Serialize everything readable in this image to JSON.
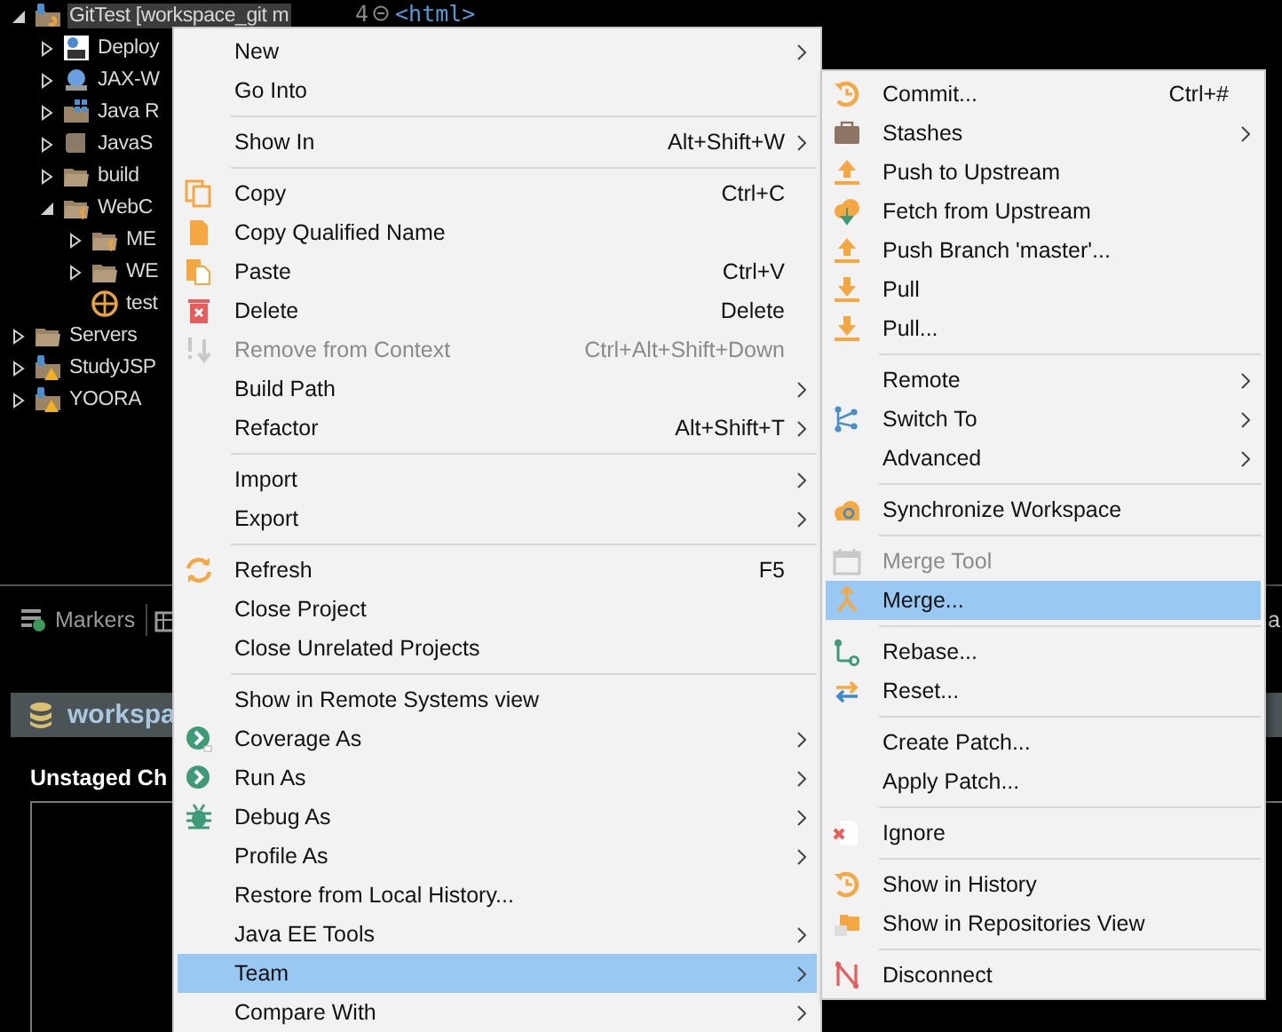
{
  "project_explorer": {
    "items": [
      {
        "label": "GitTest [workspace_git m",
        "expanded": true,
        "selected": true,
        "children": [
          {
            "label": "Deploy",
            "expanded": false,
            "selected": false
          },
          {
            "label": "JAX-W",
            "expanded": false,
            "selected": false
          },
          {
            "label": "Java R",
            "expanded": false,
            "selected": false
          },
          {
            "label": "JavaS",
            "expanded": false,
            "selected": false
          },
          {
            "label": "build",
            "expanded": false,
            "selected": false
          },
          {
            "label": "WebC",
            "expanded": true,
            "selected": false,
            "children": [
              {
                "label": "ME",
                "expanded": false,
                "selected": false
              },
              {
                "label": "WE",
                "expanded": false,
                "selected": false
              },
              {
                "label": "test",
                "selected": false
              }
            ]
          }
        ]
      },
      {
        "label": "Servers",
        "expanded": false,
        "selected": false
      },
      {
        "label": "StudyJSP",
        "expanded": false,
        "selected": false
      },
      {
        "label": "YOORA",
        "expanded": false,
        "selected": false
      }
    ]
  },
  "editor": {
    "line_number": "4",
    "code": "<html>"
  },
  "bottom_panel": {
    "tabs": [
      {
        "label": "Markers"
      }
    ],
    "edge_text": "a"
  },
  "staging_view": {
    "title": "workspa",
    "section": "Unstaged Ch"
  },
  "context_menu": {
    "groups": [
      [
        {
          "label": "New",
          "submenu": true,
          "disabled": false,
          "selected": false
        },
        {
          "label": "Go Into",
          "submenu": false,
          "disabled": false,
          "selected": false
        }
      ],
      [
        {
          "label": "Show In",
          "shortcut": "Alt+Shift+W",
          "submenu": true,
          "disabled": false,
          "selected": false
        }
      ],
      [
        {
          "label": "Copy",
          "shortcut": "Ctrl+C",
          "submenu": false,
          "disabled": false,
          "selected": false
        },
        {
          "label": "Copy Qualified Name",
          "submenu": false,
          "disabled": false,
          "selected": false
        },
        {
          "label": "Paste",
          "shortcut": "Ctrl+V",
          "submenu": false,
          "disabled": false,
          "selected": false
        },
        {
          "label": "Delete",
          "shortcut": "Delete",
          "submenu": false,
          "disabled": false,
          "selected": false
        },
        {
          "label": "Remove from Context",
          "shortcut": "Ctrl+Alt+Shift+Down",
          "submenu": false,
          "disabled": true,
          "selected": false
        },
        {
          "label": "Build Path",
          "submenu": true,
          "disabled": false,
          "selected": false
        },
        {
          "label": "Refactor",
          "shortcut": "Alt+Shift+T",
          "submenu": true,
          "disabled": false,
          "selected": false
        }
      ],
      [
        {
          "label": "Import",
          "submenu": true,
          "disabled": false,
          "selected": false
        },
        {
          "label": "Export",
          "submenu": true,
          "disabled": false,
          "selected": false
        }
      ],
      [
        {
          "label": "Refresh",
          "shortcut": "F5",
          "submenu": false,
          "disabled": false,
          "selected": false
        },
        {
          "label": "Close Project",
          "submenu": false,
          "disabled": false,
          "selected": false
        },
        {
          "label": "Close Unrelated Projects",
          "submenu": false,
          "disabled": false,
          "selected": false
        }
      ],
      [
        {
          "label": "Show in Remote Systems view",
          "submenu": false,
          "disabled": false,
          "selected": false
        },
        {
          "label": "Coverage As",
          "submenu": true,
          "disabled": false,
          "selected": false
        },
        {
          "label": "Run As",
          "submenu": true,
          "disabled": false,
          "selected": false
        },
        {
          "label": "Debug As",
          "submenu": true,
          "disabled": false,
          "selected": false
        },
        {
          "label": "Profile As",
          "submenu": true,
          "disabled": false,
          "selected": false
        },
        {
          "label": "Restore from Local History...",
          "submenu": false,
          "disabled": false,
          "selected": false
        },
        {
          "label": "Java EE Tools",
          "submenu": true,
          "disabled": false,
          "selected": false
        },
        {
          "label": "Team",
          "submenu": true,
          "disabled": false,
          "selected": true
        },
        {
          "label": "Compare With",
          "submenu": true,
          "disabled": false,
          "selected": false
        }
      ]
    ]
  },
  "team_submenu": {
    "groups": [
      [
        {
          "label": "Commit...",
          "shortcut": "Ctrl+#",
          "submenu": false,
          "disabled": false,
          "selected": false
        },
        {
          "label": "Stashes",
          "submenu": true,
          "disabled": false,
          "selected": false
        },
        {
          "label": "Push to Upstream",
          "submenu": false,
          "disabled": false,
          "selected": false
        },
        {
          "label": "Fetch from Upstream",
          "submenu": false,
          "disabled": false,
          "selected": false
        },
        {
          "label": "Push Branch 'master'...",
          "submenu": false,
          "disabled": false,
          "selected": false
        },
        {
          "label": "Pull",
          "submenu": false,
          "disabled": false,
          "selected": false
        },
        {
          "label": "Pull...",
          "submenu": false,
          "disabled": false,
          "selected": false
        }
      ],
      [
        {
          "label": "Remote",
          "submenu": true,
          "disabled": false,
          "selected": false
        },
        {
          "label": "Switch To",
          "submenu": true,
          "disabled": false,
          "selected": false
        },
        {
          "label": "Advanced",
          "submenu": true,
          "disabled": false,
          "selected": false
        }
      ],
      [
        {
          "label": "Synchronize Workspace",
          "submenu": false,
          "disabled": false,
          "selected": false
        }
      ],
      [
        {
          "label": "Merge Tool",
          "submenu": false,
          "disabled": true,
          "selected": false
        },
        {
          "label": "Merge...",
          "submenu": false,
          "disabled": false,
          "selected": true
        }
      ],
      [
        {
          "label": "Rebase...",
          "submenu": false,
          "disabled": false,
          "selected": false
        },
        {
          "label": "Reset...",
          "submenu": false,
          "disabled": false,
          "selected": false
        }
      ],
      [
        {
          "label": "Create Patch...",
          "submenu": false,
          "disabled": false,
          "selected": false
        },
        {
          "label": "Apply Patch...",
          "submenu": false,
          "disabled": false,
          "selected": false
        }
      ],
      [
        {
          "label": "Ignore",
          "submenu": false,
          "disabled": false,
          "selected": false
        }
      ],
      [
        {
          "label": "Show in History",
          "submenu": false,
          "disabled": false,
          "selected": false
        },
        {
          "label": "Show in Repositories View",
          "submenu": false,
          "disabled": false,
          "selected": false
        }
      ],
      [
        {
          "label": "Disconnect",
          "submenu": false,
          "disabled": false,
          "selected": false
        }
      ]
    ]
  }
}
